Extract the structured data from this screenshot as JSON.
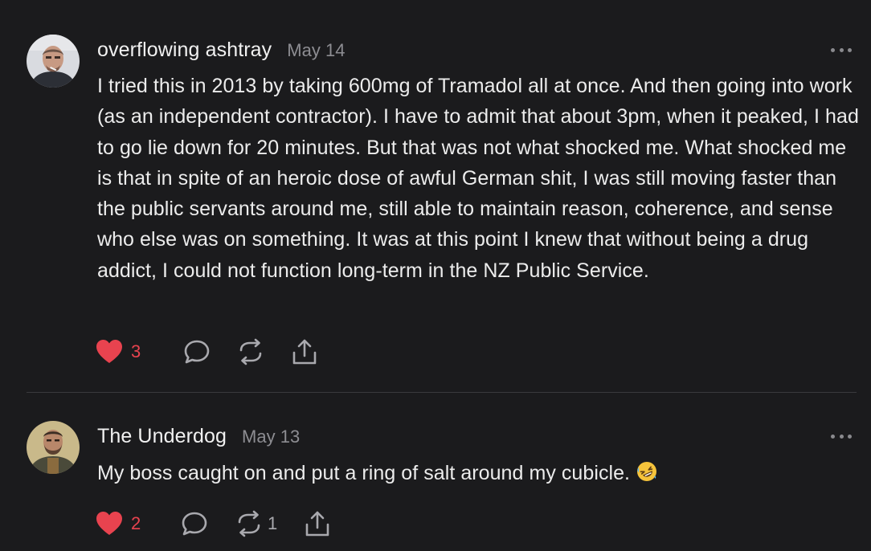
{
  "comments": [
    {
      "author": "overflowing ashtray",
      "date": "May 14",
      "avatar": "man-with-cigarette-avatar",
      "text": "I tried this in 2013 by taking 600mg of Tramadol all at once. And then going into work (as an independent contractor). I have to admit that about 3pm, when it peaked, I had to go lie down for 20 minutes. But that was not what shocked me. What shocked me is that in spite of an heroic dose of awful German shit, I was still moving faster than the public servants around me, still able to maintain reason, coherence, and sense who else was on something. It was at this point I knew that without being a drug addict, I could not function long-term in the NZ Public Service.",
      "likes": "3",
      "restacks": "",
      "liked": true
    },
    {
      "author": "The Underdog",
      "date": "May 13",
      "avatar": "bearded-man-avatar",
      "text": "My boss caught on and put a ring of salt around my cubicle.",
      "emoji": "rolling-on-floor-laughing-emoji",
      "likes": "2",
      "restacks": "1",
      "liked": true
    }
  ],
  "colors": {
    "background": "#1b1b1d",
    "like": "#e8434f",
    "muted": "#8d8d92",
    "text": "#ececec"
  },
  "icons": [
    "heart-icon",
    "comment-icon",
    "restack-icon",
    "share-icon",
    "more-icon"
  ]
}
